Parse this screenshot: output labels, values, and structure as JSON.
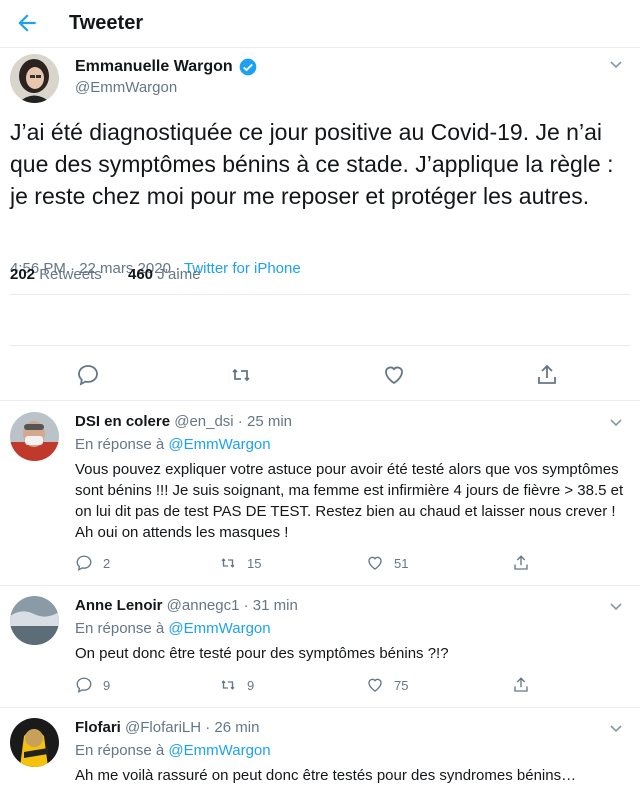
{
  "header": {
    "title": "Tweeter"
  },
  "main": {
    "author_name": "Emmanuelle Wargon",
    "author_handle": "@EmmWargon",
    "text": "J’ai été diagnostiquée ce jour positive au Covid-19. Je n’ai que des symptômes bénins à ce stade. J’applique la règle : je reste chez moi pour me reposer et protéger les autres.",
    "time": "4:56 PM · 22 mars 2020 · ",
    "source": "Twitter for iPhone",
    "retweets_count": "202",
    "retweets_label": " Retweets",
    "likes_count": "460",
    "likes_label": " J’aime"
  },
  "replies": [
    {
      "name": "DSI en colere",
      "handle_time": " @en_dsi · 25 min",
      "reply_prefix": "En réponse à ",
      "reply_to": "@EmmWargon",
      "text": "Vous pouvez expliquer votre astuce pour avoir été testé alors que vos symptômes sont bénins !!! Je suis soignant, ma femme est infirmière 4 jours de fièvre > 38.5 et on lui dit pas de test PAS DE TEST. Restez bien au chaud et laisser nous crever ! Ah oui on attends les masques !",
      "comments": "2",
      "retweets": "15",
      "likes": "51"
    },
    {
      "name": "Anne Lenoir",
      "handle_time": " @annegc1 · 31 min",
      "reply_prefix": "En réponse à ",
      "reply_to": "@EmmWargon",
      "text": "On peut donc être testé pour des symptômes bénins ?!?",
      "comments": "9",
      "retweets": "9",
      "likes": "75"
    },
    {
      "name": "Flofari",
      "handle_time": " @FlofariLH · 26 min",
      "reply_prefix": "En réponse à ",
      "reply_to": "@EmmWargon",
      "text": "Ah me voilà rassuré on peut donc être testés pour des syndromes bénins…"
    }
  ],
  "colors": {
    "accent": "#1da1f2",
    "secondary_text": "#657786",
    "border": "#e6ecf0"
  }
}
